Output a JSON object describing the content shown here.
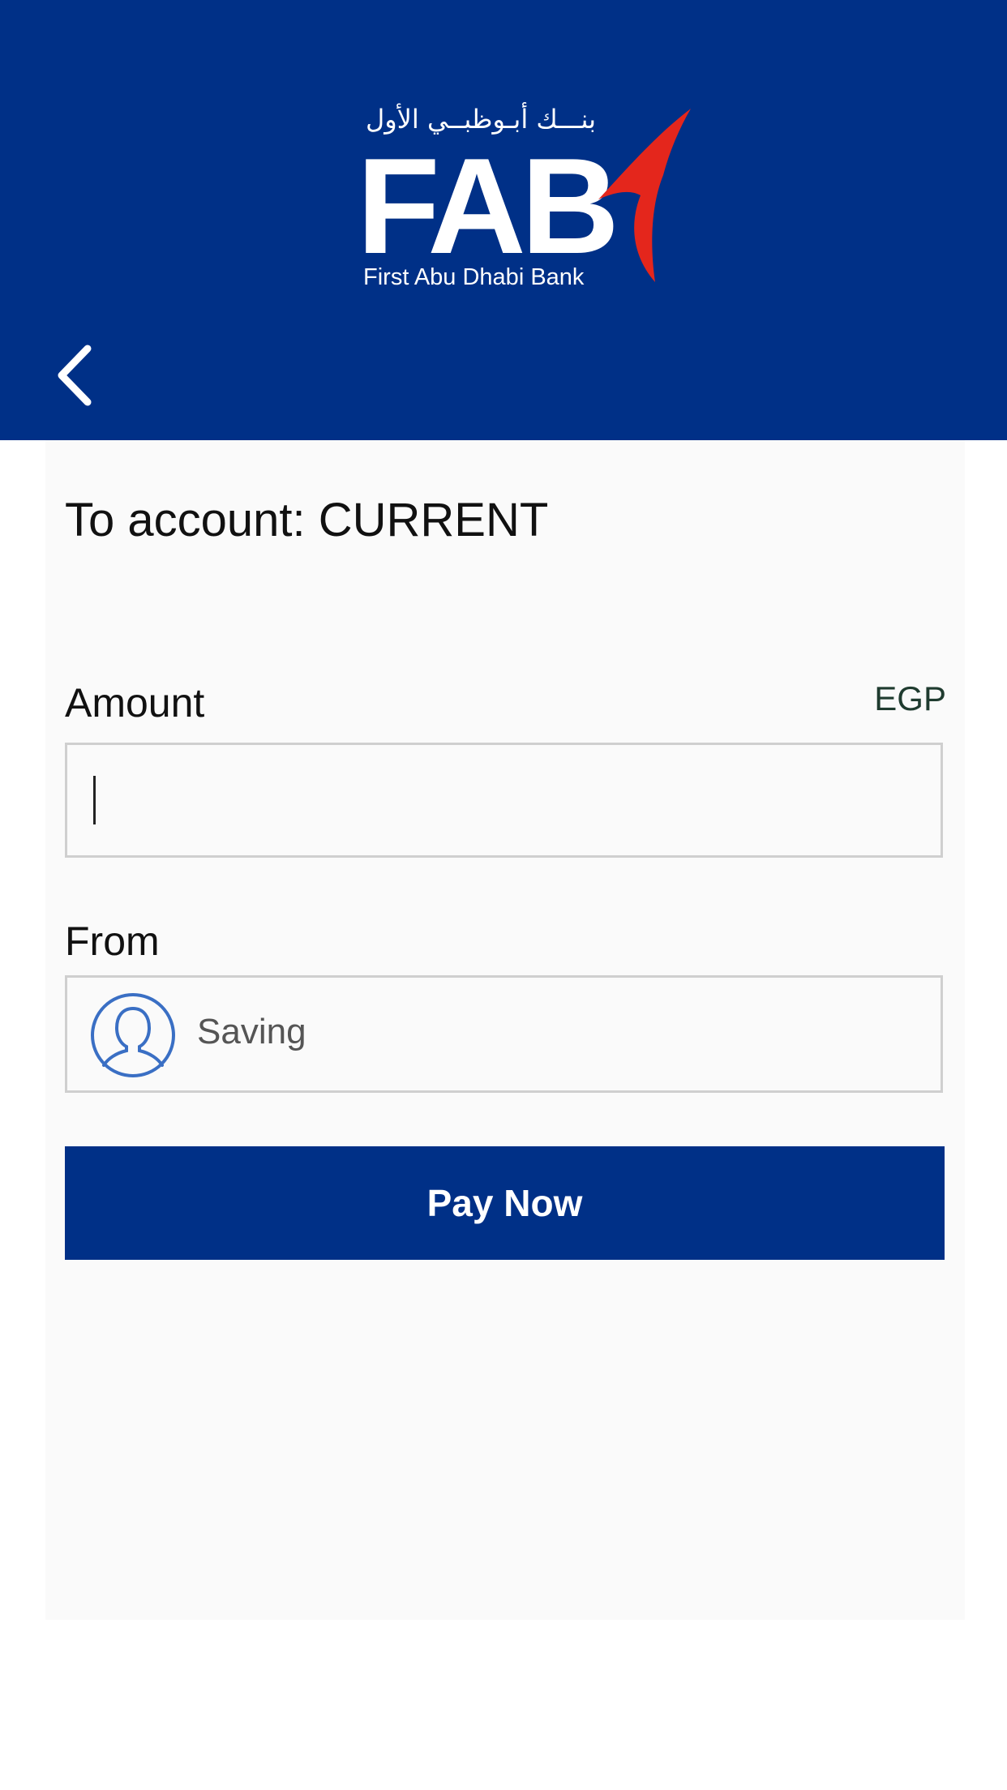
{
  "header": {
    "logo_arabic": "بنـــك أبـوظبــي الأول",
    "logo_text": "FAB",
    "logo_subtitle": "First Abu Dhabi Bank",
    "brand_color": "#003087",
    "accent_color": "#E4261C",
    "back_icon": "chevron-left-icon"
  },
  "form": {
    "to_account": "To account: CURRENT",
    "amount_label": "Amount",
    "currency": "EGP",
    "amount_value": "",
    "from_label": "From",
    "from_value": "Saving",
    "from_icon": "user-avatar-icon",
    "pay_button": "Pay Now"
  }
}
